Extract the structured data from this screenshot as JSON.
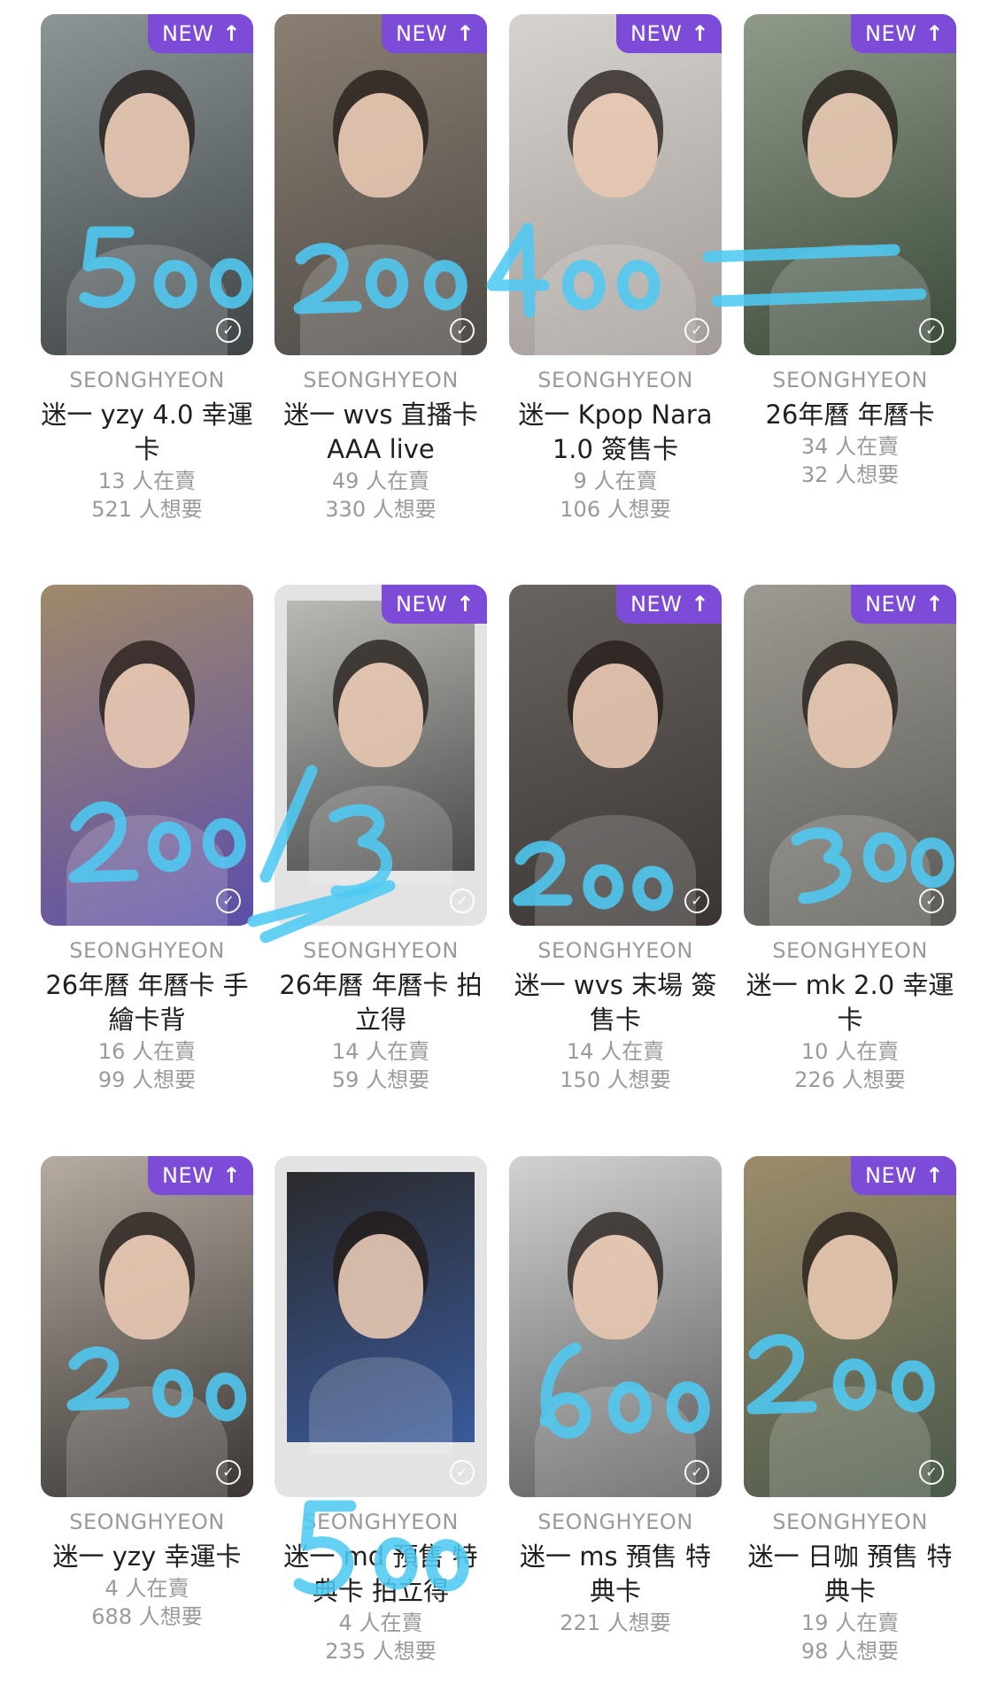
{
  "badge": {
    "label": "NEW",
    "arrow": "↑"
  },
  "check_icon": "✓",
  "cards": [
    {
      "artist": "SEONGHYEON",
      "title": "迷一 yzy 4.0 幸運卡",
      "sellers": "13 人在賣",
      "wanted": "521 人想要",
      "is_new": true,
      "polaroid": false,
      "colors": [
        "#8c9597",
        "#3f4547"
      ]
    },
    {
      "artist": "SEONGHYEON",
      "title": "迷一 wvs 直播卡 AAA live",
      "sellers": "49 人在賣",
      "wanted": "330 人想要",
      "is_new": true,
      "polaroid": false,
      "colors": [
        "#8a7f73",
        "#4e4a46"
      ]
    },
    {
      "artist": "SEONGHYEON",
      "title": "迷一 Kpop Nara 1.0 簽售卡",
      "sellers": "9 人在賣",
      "wanted": "106 人想要",
      "is_new": true,
      "polaroid": false,
      "colors": [
        "#d6d3d0",
        "#a39b96"
      ]
    },
    {
      "artist": "SEONGHYEON",
      "title": "26年曆 年曆卡",
      "sellers": "34 人在賣",
      "wanted": "32 人想要",
      "is_new": true,
      "polaroid": false,
      "colors": [
        "#8f9a8a",
        "#3c4a3a"
      ]
    },
    {
      "artist": "SEONGHYEON",
      "title": "26年曆 年曆卡 手繪卡背",
      "sellers": "16 人在賣",
      "wanted": "99 人想要",
      "is_new": false,
      "polaroid": false,
      "colors": [
        "#9f8a6a",
        "#5d4da8"
      ]
    },
    {
      "artist": "SEONGHYEON",
      "title": "26年曆 年曆卡 拍立得",
      "sellers": "14 人在賣",
      "wanted": "59 人想要",
      "is_new": true,
      "polaroid": true,
      "colors": [
        "#b9b9b5",
        "#4b4c4a"
      ]
    },
    {
      "artist": "SEONGHYEON",
      "title": "迷一 wvs 末場 簽售卡",
      "sellers": "14 人在賣",
      "wanted": "150 人想要",
      "is_new": true,
      "polaroid": false,
      "colors": [
        "#6a6460",
        "#3a3533"
      ]
    },
    {
      "artist": "SEONGHYEON",
      "title": "迷一 mk 2.0 幸運卡",
      "sellers": "10 人在賣",
      "wanted": "226 人想要",
      "is_new": true,
      "polaroid": false,
      "colors": [
        "#9c9a92",
        "#5b5a55"
      ]
    },
    {
      "artist": "SEONGHYEON",
      "title": "迷一 yzy 幸運卡",
      "sellers": "4 人在賣",
      "wanted": "688 人想要",
      "is_new": true,
      "polaroid": false,
      "colors": [
        "#b5aca2",
        "#3b3633"
      ]
    },
    {
      "artist": "SEONGHYEON",
      "title": "迷一 md 預售 特典卡 拍立得",
      "sellers": "4 人在賣",
      "wanted": "235 人想要",
      "is_new": false,
      "polaroid": true,
      "colors": [
        "#2a2a2c",
        "#3a5a9a"
      ]
    },
    {
      "artist": "SEONGHYEON",
      "title": "迷一 ms 預售 特典卡",
      "sellers": "",
      "wanted": "221 人想要",
      "is_new": false,
      "polaroid": false,
      "colors": [
        "#d2d2d2",
        "#5a5a5a"
      ]
    },
    {
      "artist": "SEONGHYEON",
      "title": "迷一 日咖 預售 特典卡",
      "sellers": "19 人在賣",
      "wanted": "98 人想要",
      "is_new": true,
      "polaroid": false,
      "colors": [
        "#9c8c6c",
        "#4a5a4a"
      ]
    }
  ]
}
